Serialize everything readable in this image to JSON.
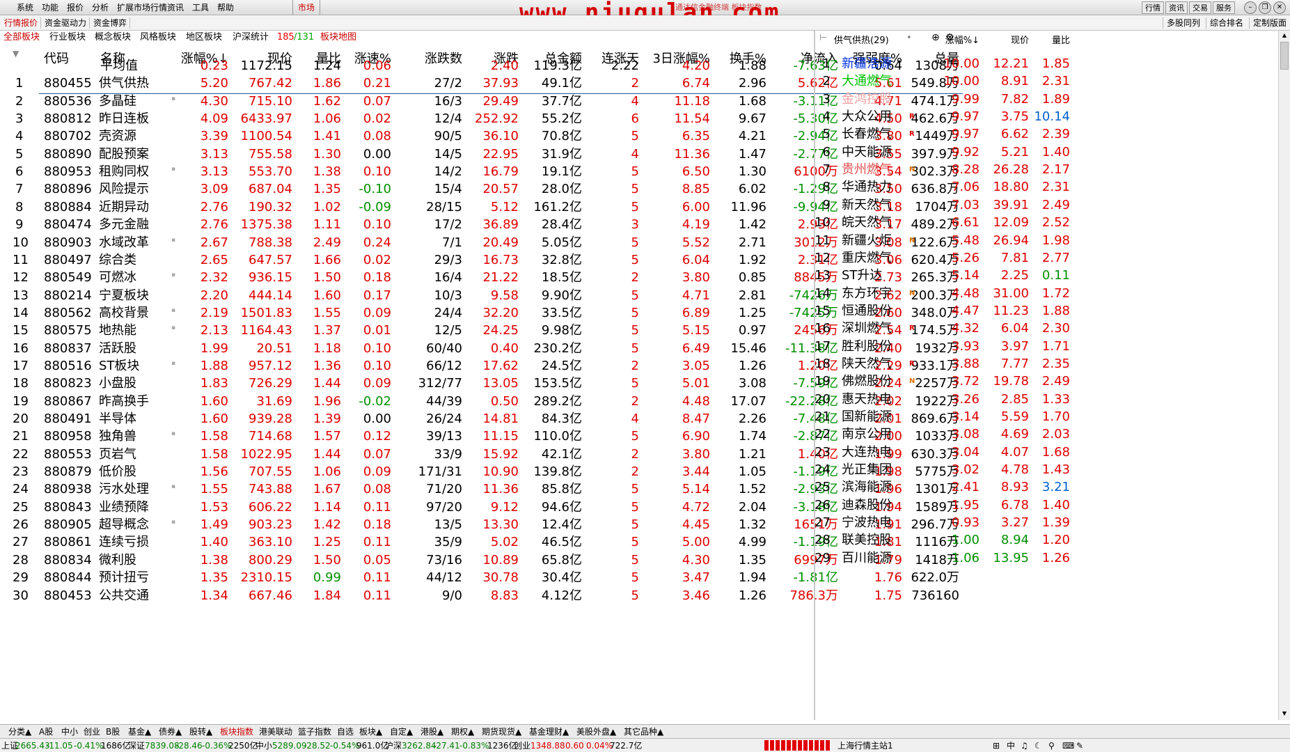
{
  "menubar": {
    "items": [
      "系统",
      "功能",
      "报价",
      "分析",
      "扩展市场行情",
      "资讯",
      "工具",
      "帮助"
    ],
    "market": "市场",
    "title": "通达信金融终端 板块指数",
    "watermark": "www.niugulan.com",
    "right_buttons": [
      "行情",
      "资讯",
      "交易",
      "服务"
    ]
  },
  "subbar": {
    "tabs": [
      "行情报价",
      "资金驱动力",
      "资金博弈"
    ],
    "right": [
      "多股同列",
      "综合排名",
      "定制版面"
    ]
  },
  "category_tabs": [
    "全部板块",
    "行业板块",
    "概念板块",
    "风格板块",
    "地区板块",
    "沪深统计"
  ],
  "count_red": "185",
  "count_sep": "/131",
  "board_map": "板块地图",
  "headers": [
    "代码",
    "名称",
    "涨幅%↓",
    "现价",
    "量比",
    "涨速%",
    "涨跌数",
    "涨跌",
    "总金额",
    "连涨天",
    "3日涨幅%",
    "换手%",
    "净流入",
    "强弱度%",
    "总量"
  ],
  "average": [
    "平均值",
    "0.23",
    "1172.15",
    "1.24",
    "0.06",
    "",
    "2.40",
    "119.3亿",
    "2.22",
    "4.20",
    "1.88",
    "-7.63亿",
    "0.64",
    "1308万"
  ],
  "rows": [
    [
      "1",
      "880455",
      "供气供热",
      "5.20",
      "767.42",
      "1.86",
      "0.21",
      "27/2",
      "37.93",
      "49.1亿",
      "2",
      "6.74",
      "2.96",
      "5.62亿",
      "5.61",
      "549.8万"
    ],
    [
      "2",
      "880536",
      "多晶硅",
      "4.30",
      "715.10",
      "1.62",
      "0.07",
      "16/3",
      "29.49",
      "37.7亿",
      "4",
      "11.18",
      "1.68",
      "-3.11亿",
      "4.71",
      "474.1万"
    ],
    [
      "3",
      "880812",
      "昨日连板",
      "4.09",
      "6433.97",
      "1.06",
      "0.02",
      "12/4",
      "252.92",
      "55.2亿",
      "6",
      "11.54",
      "9.67",
      "-5.30亿",
      "4.50",
      "462.6万"
    ],
    [
      "4",
      "880702",
      "壳资源",
      "3.39",
      "1100.54",
      "1.41",
      "0.08",
      "90/5",
      "36.10",
      "70.8亿",
      "5",
      "6.35",
      "4.21",
      "-2.94亿",
      "3.80",
      "1449万"
    ],
    [
      "5",
      "880890",
      "配股预案",
      "3.13",
      "755.58",
      "1.30",
      "0.00",
      "14/5",
      "22.95",
      "31.9亿",
      "4",
      "11.36",
      "1.47",
      "-2.77亿",
      "3.55",
      "397.9万"
    ],
    [
      "6",
      "880953",
      "租购同权",
      "3.13",
      "553.70",
      "1.38",
      "0.10",
      "14/2",
      "16.79",
      "19.1亿",
      "5",
      "6.50",
      "1.30",
      "6100万",
      "3.54",
      "302.3万"
    ],
    [
      "7",
      "880896",
      "风险提示",
      "3.09",
      "687.04",
      "1.35",
      "-0.10",
      "15/4",
      "20.57",
      "28.0亿",
      "5",
      "8.85",
      "6.02",
      "-1.29亿",
      "3.50",
      "636.8万"
    ],
    [
      "8",
      "880884",
      "近期异动",
      "2.76",
      "190.32",
      "1.02",
      "-0.09",
      "28/15",
      "5.12",
      "161.2亿",
      "5",
      "6.00",
      "11.96",
      "-9.94亿",
      "3.18",
      "1704万"
    ],
    [
      "9",
      "880474",
      "多元金融",
      "2.76",
      "1375.38",
      "1.11",
      "0.10",
      "17/2",
      "36.89",
      "28.4亿",
      "3",
      "4.19",
      "1.42",
      "2.93亿",
      "3.17",
      "489.2万"
    ],
    [
      "10",
      "880903",
      "水域改革",
      "2.67",
      "788.38",
      "2.49",
      "0.24",
      "7/1",
      "20.49",
      "5.05亿",
      "5",
      "5.52",
      "2.71",
      "3012万",
      "3.08",
      "122.6万"
    ],
    [
      "11",
      "880497",
      "综合类",
      "2.65",
      "647.57",
      "1.66",
      "0.02",
      "29/3",
      "16.73",
      "32.8亿",
      "5",
      "6.04",
      "1.92",
      "2.31亿",
      "3.06",
      "620.4万"
    ],
    [
      "12",
      "880549",
      "可燃冰",
      "2.32",
      "936.15",
      "1.50",
      "0.18",
      "16/4",
      "21.22",
      "18.5亿",
      "2",
      "3.80",
      "0.85",
      "8845万",
      "2.73",
      "265.3万"
    ],
    [
      "13",
      "880214",
      "宁夏板块",
      "2.20",
      "444.14",
      "1.60",
      "0.17",
      "10/3",
      "9.58",
      "9.90亿",
      "5",
      "4.71",
      "2.81",
      "-7426万",
      "2.62",
      "200.3万"
    ],
    [
      "14",
      "880562",
      "高校背景",
      "2.19",
      "1501.83",
      "1.55",
      "0.09",
      "24/4",
      "32.20",
      "33.5亿",
      "5",
      "6.89",
      "1.25",
      "-7425万",
      "2.60",
      "348.0万"
    ],
    [
      "15",
      "880575",
      "地热能",
      "2.13",
      "1164.43",
      "1.37",
      "0.01",
      "12/5",
      "24.25",
      "9.98亿",
      "5",
      "5.15",
      "0.97",
      "2456万",
      "2.54",
      "174.5万"
    ],
    [
      "16",
      "880837",
      "活跃股",
      "1.99",
      "20.51",
      "1.18",
      "0.10",
      "60/40",
      "0.40",
      "230.2亿",
      "5",
      "6.49",
      "15.46",
      "-11.38亿",
      "2.40",
      "1932万"
    ],
    [
      "17",
      "880516",
      "ST板块",
      "1.88",
      "957.12",
      "1.36",
      "0.10",
      "66/12",
      "17.62",
      "24.5亿",
      "2",
      "3.05",
      "1.26",
      "1.20亿",
      "2.29",
      "933.1万"
    ],
    [
      "18",
      "880823",
      "小盘股",
      "1.83",
      "726.29",
      "1.44",
      "0.09",
      "312/77",
      "13.05",
      "153.5亿",
      "5",
      "5.01",
      "3.08",
      "-7.59亿",
      "2.24",
      "2257万"
    ],
    [
      "19",
      "880867",
      "昨高换手",
      "1.60",
      "31.69",
      "1.96",
      "-0.02",
      "44/39",
      "0.50",
      "289.2亿",
      "2",
      "4.48",
      "17.07",
      "-22.28亿",
      "2.02",
      "1922万"
    ],
    [
      "20",
      "880491",
      "半导体",
      "1.60",
      "939.28",
      "1.39",
      "0.00",
      "26/24",
      "14.81",
      "84.3亿",
      "4",
      "8.47",
      "2.26",
      "-7.48亿",
      "2.01",
      "869.6万"
    ],
    [
      "21",
      "880958",
      "独角兽",
      "1.58",
      "714.68",
      "1.57",
      "0.12",
      "39/13",
      "11.15",
      "110.0亿",
      "5",
      "6.90",
      "1.74",
      "-2.87亿",
      "2.00",
      "1033万"
    ],
    [
      "22",
      "880553",
      "页岩气",
      "1.58",
      "1022.95",
      "1.44",
      "0.07",
      "33/9",
      "15.92",
      "42.1亿",
      "2",
      "3.80",
      "1.21",
      "1.40亿",
      "1.99",
      "630.3万"
    ],
    [
      "23",
      "880879",
      "低价股",
      "1.56",
      "707.55",
      "1.06",
      "0.09",
      "171/31",
      "10.90",
      "139.8亿",
      "2",
      "3.44",
      "1.05",
      "-1.19亿",
      "1.98",
      "5775万"
    ],
    [
      "24",
      "880938",
      "污水处理",
      "1.55",
      "743.88",
      "1.67",
      "0.08",
      "71/20",
      "11.36",
      "85.8亿",
      "5",
      "5.14",
      "1.52",
      "-2.93亿",
      "1.96",
      "1301万"
    ],
    [
      "25",
      "880843",
      "业绩预降",
      "1.53",
      "606.22",
      "1.14",
      "0.11",
      "97/20",
      "9.12",
      "94.6亿",
      "5",
      "4.72",
      "2.04",
      "-3.18亿",
      "1.94",
      "1589万"
    ],
    [
      "26",
      "880905",
      "超导概念",
      "1.49",
      "903.23",
      "1.42",
      "0.18",
      "13/5",
      "13.30",
      "12.4亿",
      "5",
      "4.45",
      "1.32",
      "1651万",
      "1.91",
      "296.7万"
    ],
    [
      "27",
      "880861",
      "连续亏损",
      "1.40",
      "363.10",
      "1.25",
      "0.11",
      "35/9",
      "5.02",
      "46.5亿",
      "5",
      "5.00",
      "4.99",
      "-1.19亿",
      "1.81",
      "1116万"
    ],
    [
      "28",
      "880834",
      "微利股",
      "1.38",
      "800.29",
      "1.50",
      "0.05",
      "73/16",
      "10.89",
      "65.8亿",
      "5",
      "4.30",
      "1.35",
      "6997万",
      "1.79",
      "1418万"
    ],
    [
      "29",
      "880844",
      "预计扭亏",
      "1.35",
      "2310.15",
      "0.99",
      "0.11",
      "44/12",
      "30.78",
      "30.4亿",
      "5",
      "3.47",
      "1.94",
      "-1.81亿",
      "1.76",
      "622.0万"
    ],
    [
      "30",
      "880453",
      "公共交通",
      "1.34",
      "667.46",
      "1.84",
      "0.11",
      "9/0",
      "8.83",
      "4.12亿",
      "5",
      "3.46",
      "1.26",
      "786.3万",
      "1.75",
      "736160"
    ]
  ],
  "marked_rows": [
    2,
    6,
    10,
    12,
    14,
    15,
    17,
    21,
    24,
    26
  ],
  "right_panel": {
    "title": "供气供热(29)",
    "headers": [
      "涨幅%↓",
      "现价",
      "量比"
    ],
    "rows": [
      [
        "1",
        "新疆浩源",
        "",
        "10.00",
        "12.21",
        "1.85",
        "blue"
      ],
      [
        "2",
        "大通燃气",
        "",
        "10.00",
        "8.91",
        "2.31",
        "green"
      ],
      [
        "3",
        "金鸿控股",
        "",
        "9.99",
        "7.82",
        "1.89",
        "pink"
      ],
      [
        "4",
        "大众公用",
        "R",
        "9.97",
        "3.75",
        "10.14",
        "black"
      ],
      [
        "5",
        "长春燃气",
        "R",
        "9.97",
        "6.62",
        "2.39",
        "black"
      ],
      [
        "6",
        "中天能源",
        "",
        "9.92",
        "5.21",
        "1.40",
        "black"
      ],
      [
        "7",
        "贵州燃气",
        "N",
        "8.28",
        "26.28",
        "2.17",
        "red"
      ],
      [
        "8",
        "华通热力",
        "",
        "7.06",
        "18.80",
        "2.31",
        "black"
      ],
      [
        "9",
        "新天然气",
        "",
        "7.03",
        "39.91",
        "2.49",
        "black"
      ],
      [
        "10",
        "皖天然气",
        "",
        "6.61",
        "12.09",
        "2.52",
        "black"
      ],
      [
        "11",
        "新疆火炬",
        "N",
        "5.48",
        "26.94",
        "1.98",
        "black"
      ],
      [
        "12",
        "重庆燃气",
        "",
        "5.26",
        "7.81",
        "2.77",
        "black"
      ],
      [
        "13",
        "ST升达",
        "",
        "5.14",
        "2.25",
        "0.11",
        "black"
      ],
      [
        "14",
        "东方环宇",
        "N",
        "4.48",
        "31.00",
        "1.72",
        "black"
      ],
      [
        "15",
        "恒通股份",
        "",
        "4.47",
        "11.23",
        "1.88",
        "black"
      ],
      [
        "16",
        "深圳燃气",
        "R",
        "4.32",
        "6.04",
        "2.30",
        "black"
      ],
      [
        "17",
        "胜利股份",
        "",
        "3.93",
        "3.97",
        "1.71",
        "black"
      ],
      [
        "18",
        "陕天然气",
        "R",
        "3.88",
        "7.77",
        "2.35",
        "black"
      ],
      [
        "19",
        "佛燃股份",
        "N",
        "3.72",
        "19.78",
        "2.49",
        "black"
      ],
      [
        "20",
        "惠天热电",
        "",
        "3.26",
        "2.85",
        "1.33",
        "black"
      ],
      [
        "21",
        "国新能源",
        "",
        "3.14",
        "5.59",
        "1.70",
        "black"
      ],
      [
        "22",
        "南京公用",
        "",
        "3.08",
        "4.69",
        "2.03",
        "black"
      ],
      [
        "23",
        "大连热电",
        "",
        "3.04",
        "4.07",
        "1.68",
        "black"
      ],
      [
        "24",
        "光正集团",
        "",
        "3.02",
        "4.78",
        "1.43",
        "black"
      ],
      [
        "25",
        "滨海能源",
        "",
        "2.41",
        "8.93",
        "3.21",
        "black"
      ],
      [
        "26",
        "迪森股份",
        "",
        "1.95",
        "6.78",
        "1.40",
        "black"
      ],
      [
        "27",
        "宁波热电",
        "",
        "0.93",
        "3.27",
        "1.39",
        "black"
      ],
      [
        "28",
        "联美控股",
        "",
        "-1.00",
        "8.94",
        "1.20",
        "black"
      ],
      [
        "29",
        "百川能源",
        "",
        "-1.06",
        "13.95",
        "1.26",
        "black"
      ]
    ]
  },
  "bottom_tabs": [
    "分类▲",
    "A股",
    "中小",
    "创业",
    "B股",
    "基金▲",
    "债券▲",
    "股转▲",
    "板块指数",
    "港美联动",
    "篮子指数",
    "自选",
    "板块▲",
    "自定▲",
    "港股▲",
    "期权▲",
    "期货现货▲",
    "基金理财▲",
    "美股外盘▲",
    "其它品种▲"
  ],
  "status": {
    "sh": {
      "label": "上证",
      "value": "2665.43",
      "change": "-11.05",
      "pct": "-0.41%",
      "amount": "1686亿"
    },
    "sz": {
      "label": "深证",
      "value": "7839.08",
      "change": "-28.46",
      "pct": "-0.36%",
      "amount": "2250亿"
    },
    "zx": {
      "label": "中小",
      "value": "5289.09",
      "change": "-28.52",
      "pct": "-0.54%",
      "amount": "961.0亿"
    },
    "hs": {
      "label": "沪深",
      "value": "3262.84",
      "change": "-27.41",
      "pct": "-0.83%",
      "amount": "1236亿"
    },
    "cy": {
      "label": "创业",
      "value": "1348.88",
      "change": "0.60",
      "pct": "0.04%",
      "amount": "722.7亿"
    },
    "station": "上海行情主站1",
    "mid_char": "中"
  }
}
